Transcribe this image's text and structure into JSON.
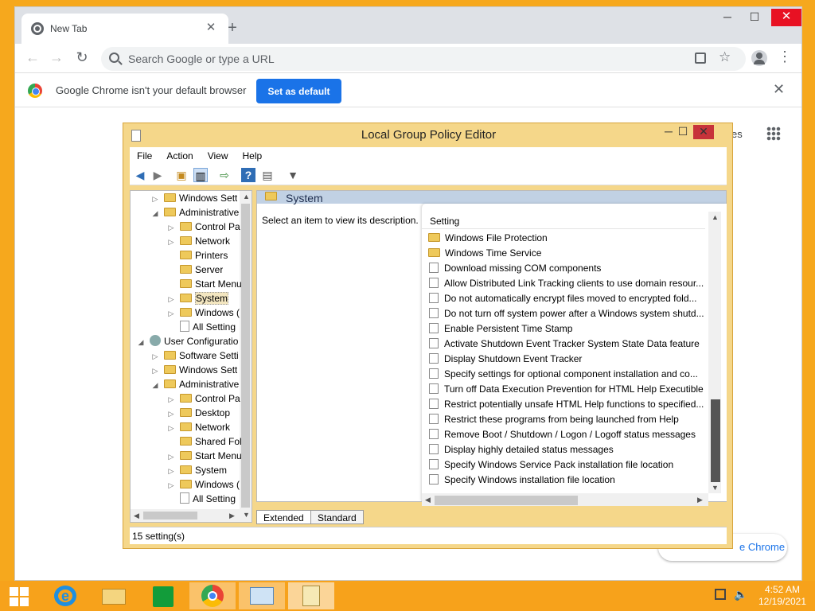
{
  "browser": {
    "tab_title": "New Tab",
    "address_placeholder": "Search Google or type a URL",
    "infobar_message": "Google Chrome isn't your default browser",
    "set_default_label": "Set as default",
    "shortcut_label_fragment": "es",
    "customize_label": "e Chrome"
  },
  "gpedit": {
    "title": "Local Group Policy Editor",
    "menu": [
      "File",
      "Action",
      "View",
      "Help"
    ],
    "tree": [
      {
        "label": "Windows Sett",
        "indent": 1,
        "expander": "right",
        "icon": "folder"
      },
      {
        "label": "Administrative",
        "indent": 1,
        "expander": "down",
        "icon": "folder"
      },
      {
        "label": "Control Pa",
        "indent": 2,
        "expander": "right",
        "icon": "folder"
      },
      {
        "label": "Network",
        "indent": 2,
        "expander": "right",
        "icon": "folder"
      },
      {
        "label": "Printers",
        "indent": 2,
        "expander": "",
        "icon": "folder"
      },
      {
        "label": "Server",
        "indent": 2,
        "expander": "",
        "icon": "folder"
      },
      {
        "label": "Start Menu",
        "indent": 2,
        "expander": "",
        "icon": "folder"
      },
      {
        "label": "System",
        "indent": 2,
        "expander": "right",
        "icon": "folder",
        "selected": true
      },
      {
        "label": "Windows (",
        "indent": 2,
        "expander": "right",
        "icon": "folder"
      },
      {
        "label": "All Setting",
        "indent": 2,
        "expander": "",
        "icon": "doc"
      },
      {
        "label": "User Configuratio",
        "indent": 0,
        "expander": "down",
        "icon": "user"
      },
      {
        "label": "Software Setti",
        "indent": 1,
        "expander": "right",
        "icon": "folder"
      },
      {
        "label": "Windows Sett",
        "indent": 1,
        "expander": "right",
        "icon": "folder"
      },
      {
        "label": "Administrative",
        "indent": 1,
        "expander": "down",
        "icon": "folder"
      },
      {
        "label": "Control Pa",
        "indent": 2,
        "expander": "right",
        "icon": "folder"
      },
      {
        "label": "Desktop",
        "indent": 2,
        "expander": "right",
        "icon": "folder"
      },
      {
        "label": "Network",
        "indent": 2,
        "expander": "right",
        "icon": "folder"
      },
      {
        "label": "Shared Fol",
        "indent": 2,
        "expander": "",
        "icon": "folder"
      },
      {
        "label": "Start Menu",
        "indent": 2,
        "expander": "right",
        "icon": "folder"
      },
      {
        "label": "System",
        "indent": 2,
        "expander": "right",
        "icon": "folder"
      },
      {
        "label": "Windows (",
        "indent": 2,
        "expander": "right",
        "icon": "folder"
      },
      {
        "label": "All Setting",
        "indent": 2,
        "expander": "",
        "icon": "doc"
      }
    ],
    "panel_title": "System",
    "description": "Select an item to view its description.",
    "column_header": "Setting",
    "settings": [
      {
        "label": "Windows File Protection",
        "icon": "folder"
      },
      {
        "label": "Windows Time Service",
        "icon": "folder"
      },
      {
        "label": "Download missing COM components",
        "icon": "policy"
      },
      {
        "label": "Allow Distributed Link Tracking clients to use domain resour...",
        "icon": "policy"
      },
      {
        "label": "Do not automatically encrypt files moved to encrypted fold...",
        "icon": "policy"
      },
      {
        "label": "Do not turn off system power after a Windows system shutd...",
        "icon": "policy"
      },
      {
        "label": "Enable Persistent Time Stamp",
        "icon": "policy"
      },
      {
        "label": "Activate Shutdown Event Tracker System State Data feature",
        "icon": "policy"
      },
      {
        "label": "Display Shutdown Event Tracker",
        "icon": "policy"
      },
      {
        "label": "Specify settings for optional component installation and co...",
        "icon": "policy"
      },
      {
        "label": "Turn off Data Execution Prevention for HTML Help Executible",
        "icon": "policy"
      },
      {
        "label": "Restrict potentially unsafe HTML Help functions to specified...",
        "icon": "policy"
      },
      {
        "label": "Restrict these programs from being launched from Help",
        "icon": "policy"
      },
      {
        "label": "Remove Boot / Shutdown / Logon / Logoff status messages",
        "icon": "policy"
      },
      {
        "label": "Display highly detailed status messages",
        "icon": "policy"
      },
      {
        "label": "Specify Windows Service Pack installation file location",
        "icon": "policy"
      },
      {
        "label": "Specify Windows installation file location",
        "icon": "policy"
      }
    ],
    "tabs": [
      "Extended",
      "Standard"
    ],
    "status": "15 setting(s)"
  },
  "taskbar": {
    "time": "4:52 AM",
    "date": "12/19/2021"
  },
  "colors": {
    "desktop": "#f6a81d",
    "accent_blue": "#1a73e8",
    "close_red": "#c7333a"
  }
}
